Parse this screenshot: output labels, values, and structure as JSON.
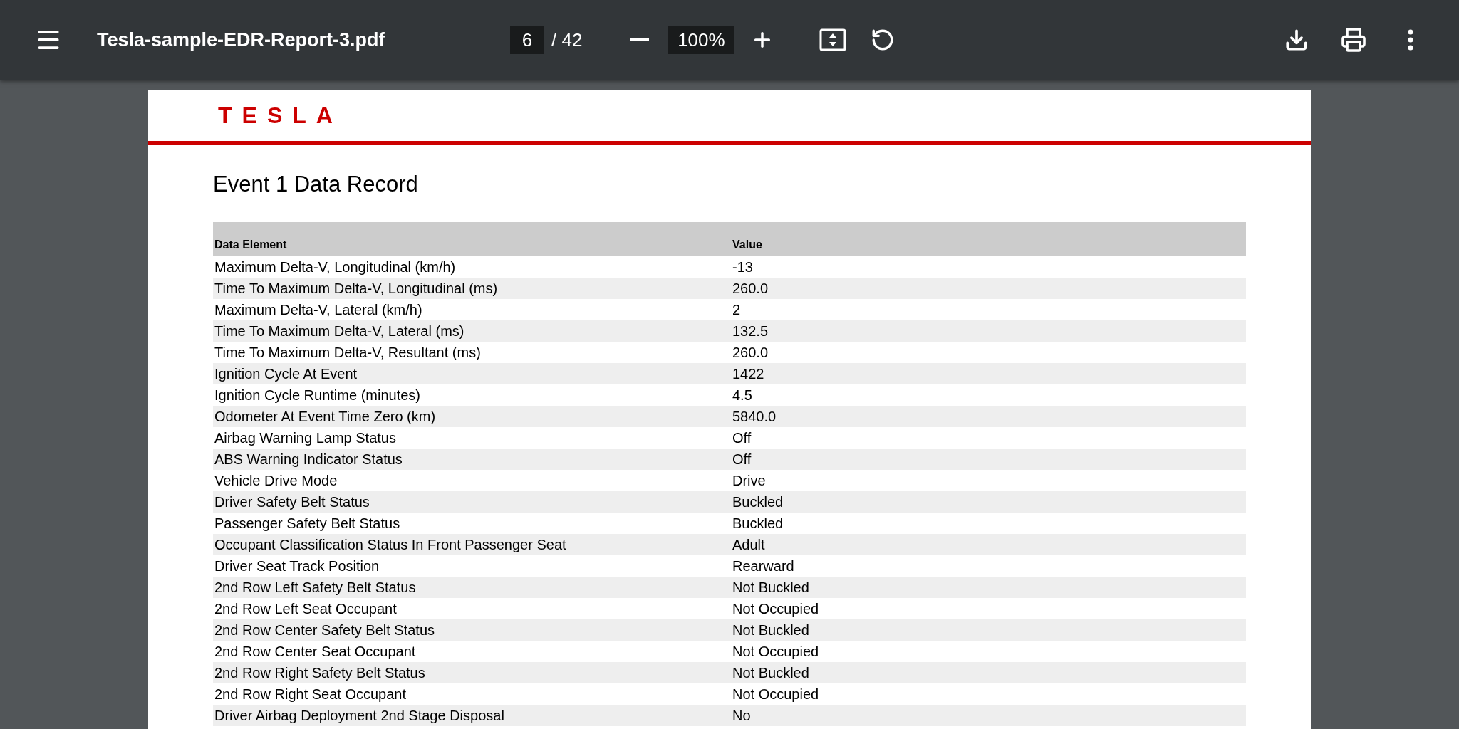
{
  "toolbar": {
    "title": "Tesla-sample-EDR-Report-3.pdf",
    "page": "6",
    "page_total": "/ 42",
    "zoom": "100%"
  },
  "document": {
    "logo": "TESLA",
    "heading": "Event 1 Data Record",
    "table": {
      "columns": [
        "Data Element",
        "Value"
      ],
      "rows": [
        [
          "Maximum Delta-V, Longitudinal (km/h)",
          "-13"
        ],
        [
          "Time To Maximum Delta-V, Longitudinal (ms)",
          "260.0"
        ],
        [
          "Maximum Delta-V, Lateral (km/h)",
          "2"
        ],
        [
          "Time To Maximum Delta-V, Lateral (ms)",
          "132.5"
        ],
        [
          "Time To Maximum Delta-V, Resultant (ms)",
          "260.0"
        ],
        [
          "Ignition Cycle At Event",
          "1422"
        ],
        [
          "Ignition Cycle Runtime (minutes)",
          "4.5"
        ],
        [
          "Odometer At Event Time Zero (km)",
          "5840.0"
        ],
        [
          "Airbag Warning Lamp Status",
          "Off"
        ],
        [
          "ABS Warning Indicator Status",
          "Off"
        ],
        [
          "Vehicle Drive Mode",
          "Drive"
        ],
        [
          "Driver Safety Belt Status",
          "Buckled"
        ],
        [
          "Passenger Safety Belt Status",
          "Buckled"
        ],
        [
          "Occupant Classification Status In Front Passenger Seat",
          "Adult"
        ],
        [
          "Driver Seat Track Position",
          "Rearward"
        ],
        [
          "2nd Row Left Safety Belt Status",
          "Not Buckled"
        ],
        [
          "2nd Row Left Seat Occupant",
          "Not Occupied"
        ],
        [
          "2nd Row Center Safety Belt Status",
          "Not Buckled"
        ],
        [
          "2nd Row Center Seat Occupant",
          "Not Occupied"
        ],
        [
          "2nd Row Right Safety Belt Status",
          "Not Buckled"
        ],
        [
          "2nd Row Right Seat Occupant",
          "Not Occupied"
        ],
        [
          "Driver Airbag Deployment 2nd Stage Disposal",
          "No"
        ]
      ]
    }
  }
}
